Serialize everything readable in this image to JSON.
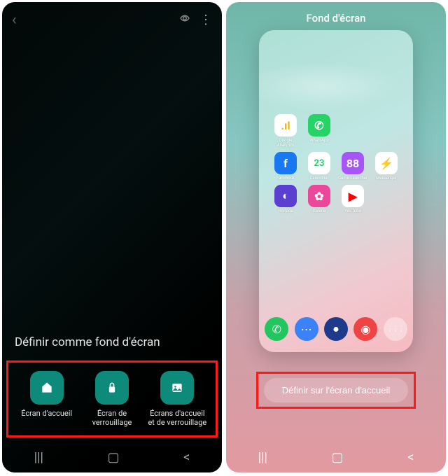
{
  "left": {
    "title": "Définir comme fond d'écran",
    "options": [
      {
        "label": "Écran d'accueil",
        "icon": "home-icon"
      },
      {
        "label": "Écran de verrouillage",
        "icon": "lock-icon"
      },
      {
        "label": "Écrans d'accueil et de verrouillage",
        "icon": "picture-icon"
      }
    ]
  },
  "right": {
    "title": "Fond d'écran",
    "apps_row1": [
      {
        "label": "Google Analytics",
        "glyph": ".ıl",
        "class": "analytics"
      },
      {
        "label": "WhatsApp",
        "glyph": "✆",
        "class": "whatsapp"
      }
    ],
    "apps_row2": [
      {
        "label": "Facebook",
        "glyph": "f",
        "class": "facebook"
      },
      {
        "label": "Calendrier",
        "glyph": "23",
        "class": "calendar"
      },
      {
        "label": "Game Launcher",
        "glyph": "88",
        "class": "launcher"
      },
      {
        "label": "Messenger",
        "glyph": "⚡",
        "class": "messenger"
      }
    ],
    "apps_row3": [
      {
        "label": "Horloge",
        "glyph": "◐",
        "class": "clock"
      },
      {
        "label": "Galerie",
        "glyph": "✿",
        "class": "gallery"
      },
      {
        "label": "YouTube",
        "glyph": "▶",
        "class": "youtube"
      }
    ],
    "dock": [
      {
        "name": "phone",
        "glyph": "✆",
        "class": "dock-phone"
      },
      {
        "name": "messages",
        "glyph": "⋯",
        "class": "dock-msg"
      },
      {
        "name": "browser",
        "glyph": "●",
        "class": "dock-browser"
      },
      {
        "name": "camera",
        "glyph": "◉",
        "class": "dock-cam"
      },
      {
        "name": "apps",
        "glyph": "⋮⋮⋮",
        "class": "dock-apps"
      }
    ],
    "set_button": "Définir sur l'écran d'accueil"
  },
  "nav": {
    "recent": "|||",
    "home": "▢",
    "back": "<"
  },
  "colors": {
    "highlight": "#ff1a1a",
    "option_tile": "#0e8a7a"
  }
}
